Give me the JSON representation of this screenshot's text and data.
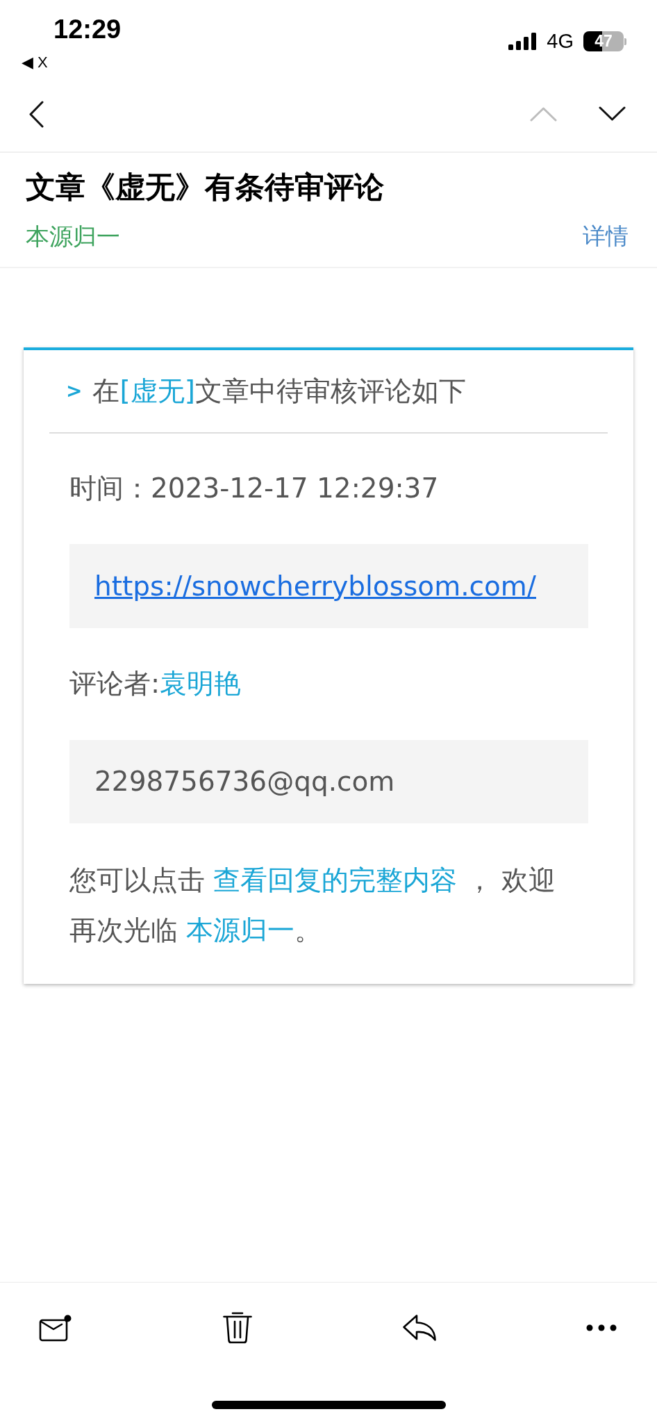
{
  "status_bar": {
    "time": "12:29",
    "return_label": "◀ X",
    "network": "4G",
    "battery": "47"
  },
  "nav": {
    "buttons": [
      {
        "kind": "back",
        "disabled": false
      },
      {
        "kind": "previous",
        "disabled": true
      },
      {
        "kind": "next",
        "disabled": false
      }
    ]
  },
  "message": {
    "subject": "文章《虚无》有条待审评论",
    "sender": "本源归一",
    "details_link": "详情"
  },
  "card": {
    "heading": {
      "marker": ">",
      "parts": [
        {
          "kind": "text",
          "text": "在"
        },
        {
          "kind": "link",
          "text": "[虚无]"
        },
        {
          "kind": "text",
          "text": "文章中待审核评论如下"
        }
      ]
    },
    "time": "时间：2023-12-17 12:29:37",
    "url": "https://snowcherryblossom.com/",
    "commenter": {
      "label": "评论者:",
      "name": "袁明艳"
    },
    "email": "2298756736@qq.com",
    "closing": [
      {
        "kind": "text",
        "text": "您可以点击 "
      },
      {
        "kind": "link",
        "text": "查看回复的完整内容"
      },
      {
        "kind": "text",
        "text": " ， 欢迎再次光临 "
      },
      {
        "kind": "link",
        "text": "本源归一"
      },
      {
        "kind": "text",
        "text": "。"
      }
    ]
  },
  "toolbar": {
    "buttons": [
      {
        "kind": "mark-unread"
      },
      {
        "kind": "delete"
      },
      {
        "kind": "reply"
      },
      {
        "kind": "more"
      }
    ]
  }
}
